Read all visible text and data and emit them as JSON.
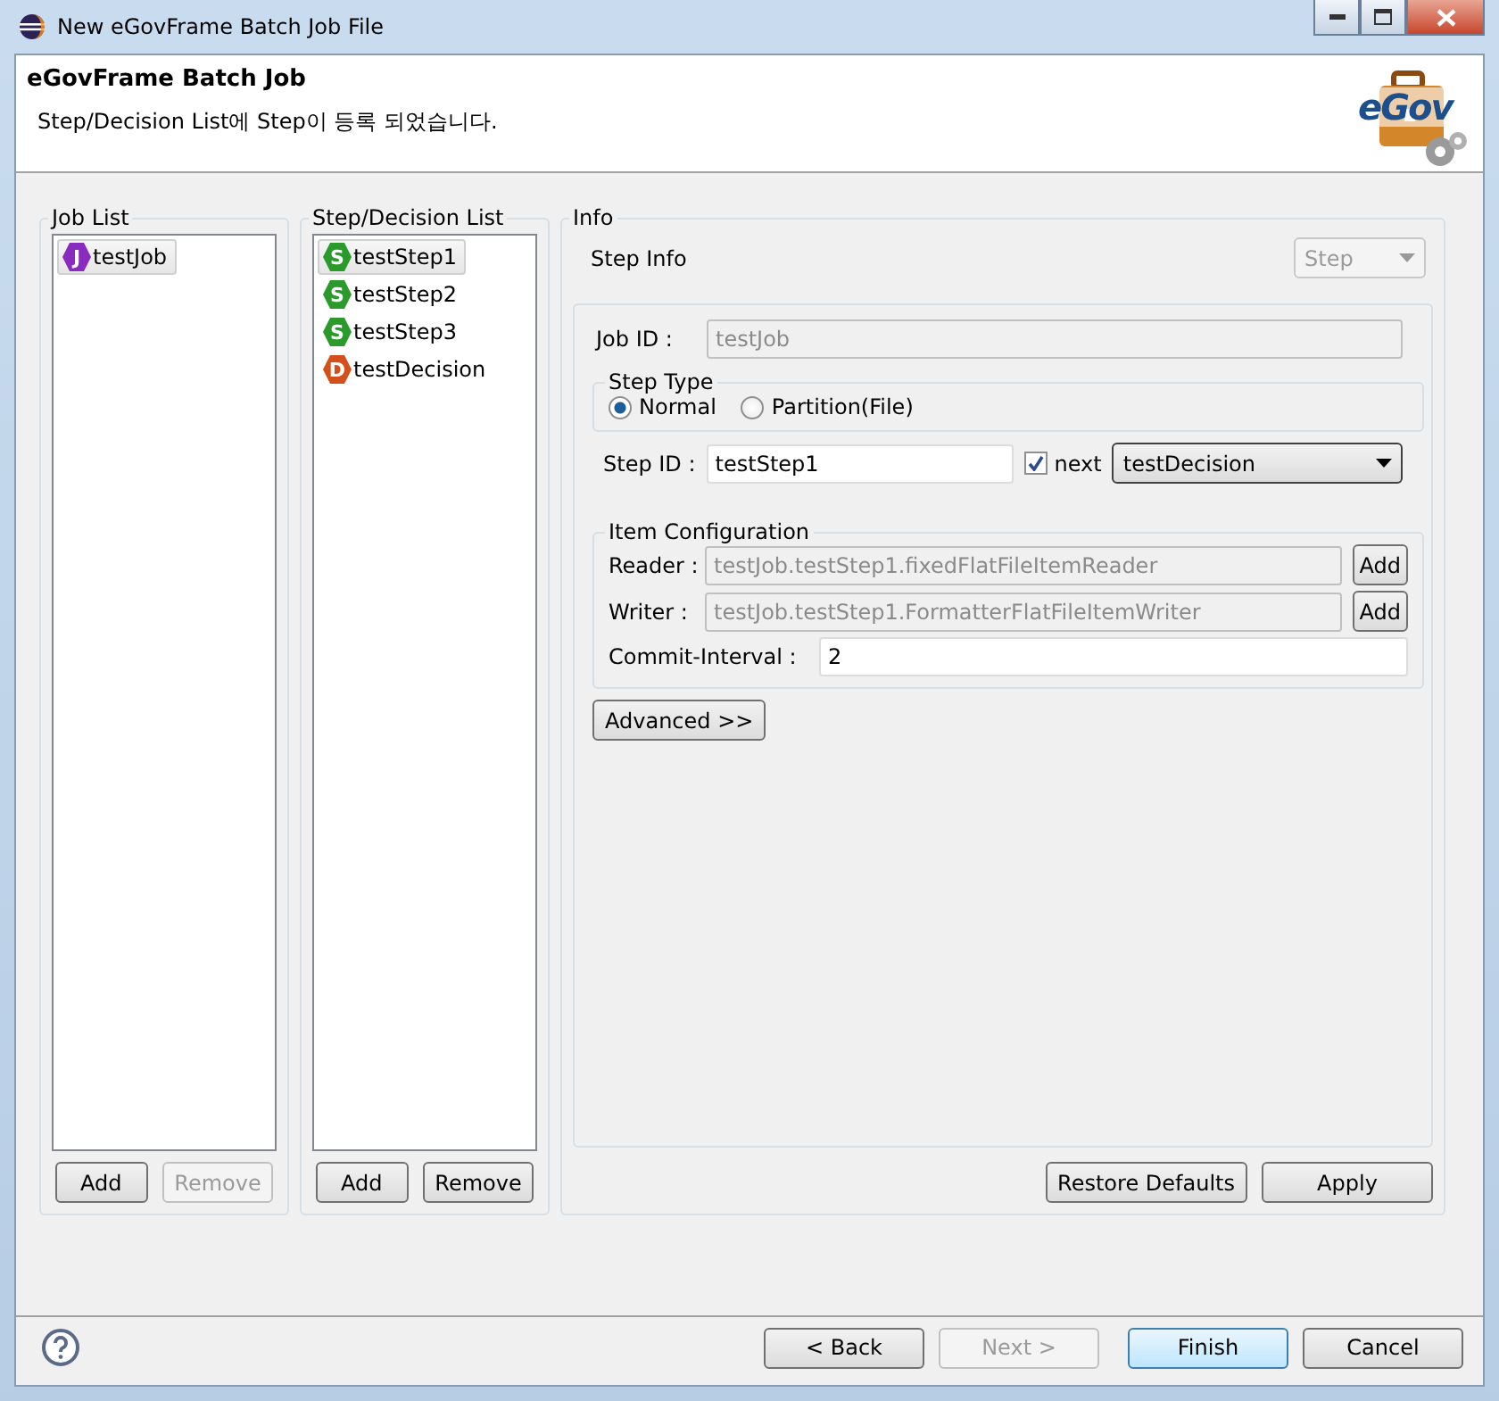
{
  "window": {
    "title": "New eGovFrame Batch Job File"
  },
  "header": {
    "title": "eGovFrame Batch Job",
    "message": "Step/Decision List에 Step이 등록 되었습니다.",
    "logo_text": "eGov"
  },
  "job_list": {
    "title": "Job List",
    "items": [
      {
        "kind": "job",
        "badge": "J",
        "label": "testJob",
        "selected": true
      }
    ],
    "buttons": [
      {
        "label": "Add",
        "disabled": false
      },
      {
        "label": "Remove",
        "disabled": true
      }
    ]
  },
  "step_list": {
    "title": "Step/Decision List",
    "items": [
      {
        "kind": "step",
        "badge": "S",
        "label": "testStep1",
        "selected": true
      },
      {
        "kind": "step",
        "badge": "S",
        "label": "testStep2",
        "selected": false
      },
      {
        "kind": "step",
        "badge": "S",
        "label": "testStep3",
        "selected": false
      },
      {
        "kind": "decision",
        "badge": "D",
        "label": "testDecision",
        "selected": false
      }
    ],
    "buttons": [
      {
        "label": "Add",
        "disabled": false
      },
      {
        "label": "Remove",
        "disabled": false
      }
    ]
  },
  "info": {
    "title": "Info",
    "section_title": "Step Info",
    "type_select": {
      "value": "Step",
      "disabled": true
    },
    "job_id": {
      "label": "Job ID :",
      "value": "testJob"
    },
    "step_type": {
      "title": "Step Type",
      "options": [
        {
          "label": "Normal",
          "selected": true
        },
        {
          "label": "Partition(File)",
          "selected": false
        }
      ]
    },
    "step_id": {
      "label": "Step ID :",
      "value": "testStep1"
    },
    "next": {
      "label": "next",
      "checked": true,
      "value": "testDecision"
    },
    "item_configuration": {
      "title": "Item Configuration",
      "rows": [
        {
          "label": "Reader :",
          "value": "testJob.testStep1.fixedFlatFileItemReader",
          "button": "Add"
        },
        {
          "label": "Writer :",
          "value": "testJob.testStep1.FormatterFlatFileItemWriter",
          "button": "Add"
        }
      ],
      "commit_interval": {
        "label": "Commit-Interval :",
        "value": "2"
      }
    },
    "advanced_button": "Advanced >>",
    "buttons": [
      "Restore Defaults",
      "Apply"
    ]
  },
  "footer": {
    "buttons": [
      {
        "label": "< Back",
        "disabled": false,
        "default": false
      },
      {
        "label": "Next >",
        "disabled": true,
        "default": false
      },
      {
        "label": "Finish",
        "disabled": false,
        "default": true
      },
      {
        "label": "Cancel",
        "disabled": false,
        "default": false
      }
    ]
  }
}
